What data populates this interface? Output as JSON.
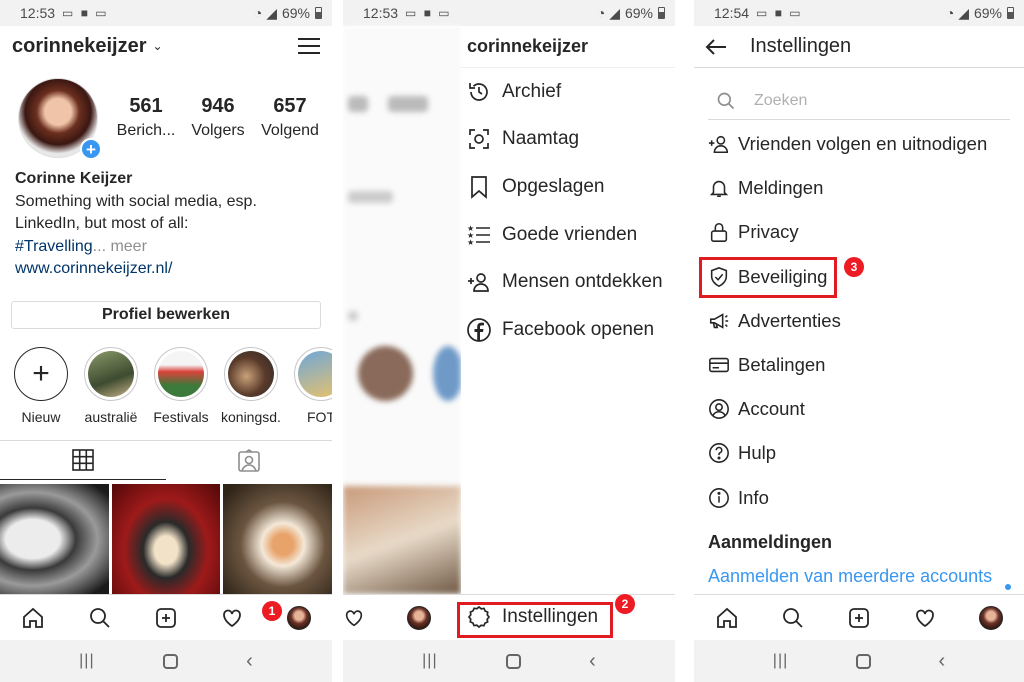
{
  "panel1": {
    "status": {
      "time": "12:53",
      "battery": "69%"
    },
    "header": {
      "username": "corinnekeijzer",
      "caret": "⌄"
    },
    "stats": [
      {
        "value": "561",
        "label": "Berich..."
      },
      {
        "value": "946",
        "label": "Volgers"
      },
      {
        "value": "657",
        "label": "Volgend"
      }
    ],
    "bio": {
      "name": "Corinne Keijzer",
      "line1": "Something with social media, esp.",
      "line2": "LinkedIn, but most of all:",
      "hashtag": "#Travelling",
      "more": "... meer",
      "link": "www.corinnekeijzer.nl/"
    },
    "edit_button": "Profiel bewerken",
    "highlights": [
      {
        "label": "Nieuw"
      },
      {
        "label": "australië"
      },
      {
        "label": "Festivals"
      },
      {
        "label": "koningsd..."
      },
      {
        "label": "FOT"
      }
    ],
    "badge": "1"
  },
  "panel2": {
    "status": {
      "time": "12:53",
      "battery": "69%"
    },
    "drawer_title": "corinnekeijzer",
    "menu": [
      {
        "label": "Archief",
        "icon": "archive-clock-icon"
      },
      {
        "label": "Naamtag",
        "icon": "nametag-icon"
      },
      {
        "label": "Opgeslagen",
        "icon": "bookmark-icon"
      },
      {
        "label": "Goede vrienden",
        "icon": "close-friends-list-icon"
      },
      {
        "label": "Mensen ontdekken",
        "icon": "add-person-icon"
      },
      {
        "label": "Facebook openen",
        "icon": "facebook-icon"
      }
    ],
    "settings_label": "Instellingen",
    "badge": "2"
  },
  "panel3": {
    "status": {
      "time": "12:54",
      "battery": "69%"
    },
    "title": "Instellingen",
    "search_placeholder": "Zoeken",
    "items": [
      {
        "label": "Vrienden volgen en uitnodigen",
        "icon": "add-person-icon"
      },
      {
        "label": "Meldingen",
        "icon": "bell-icon"
      },
      {
        "label": "Privacy",
        "icon": "lock-icon"
      },
      {
        "label": "Beveiliging",
        "icon": "shield-icon"
      },
      {
        "label": "Advertenties",
        "icon": "megaphone-icon"
      },
      {
        "label": "Betalingen",
        "icon": "card-icon"
      },
      {
        "label": "Account",
        "icon": "account-icon"
      },
      {
        "label": "Hulp",
        "icon": "help-icon"
      },
      {
        "label": "Info",
        "icon": "info-icon"
      }
    ],
    "section_heading": "Aanmeldingen",
    "section_link": "Aanmelden van meerdere accounts",
    "badge": "3"
  },
  "colors": {
    "accent_blue": "#3897f0",
    "annotation_red": "#e01b22",
    "link_navy": "#003569"
  }
}
